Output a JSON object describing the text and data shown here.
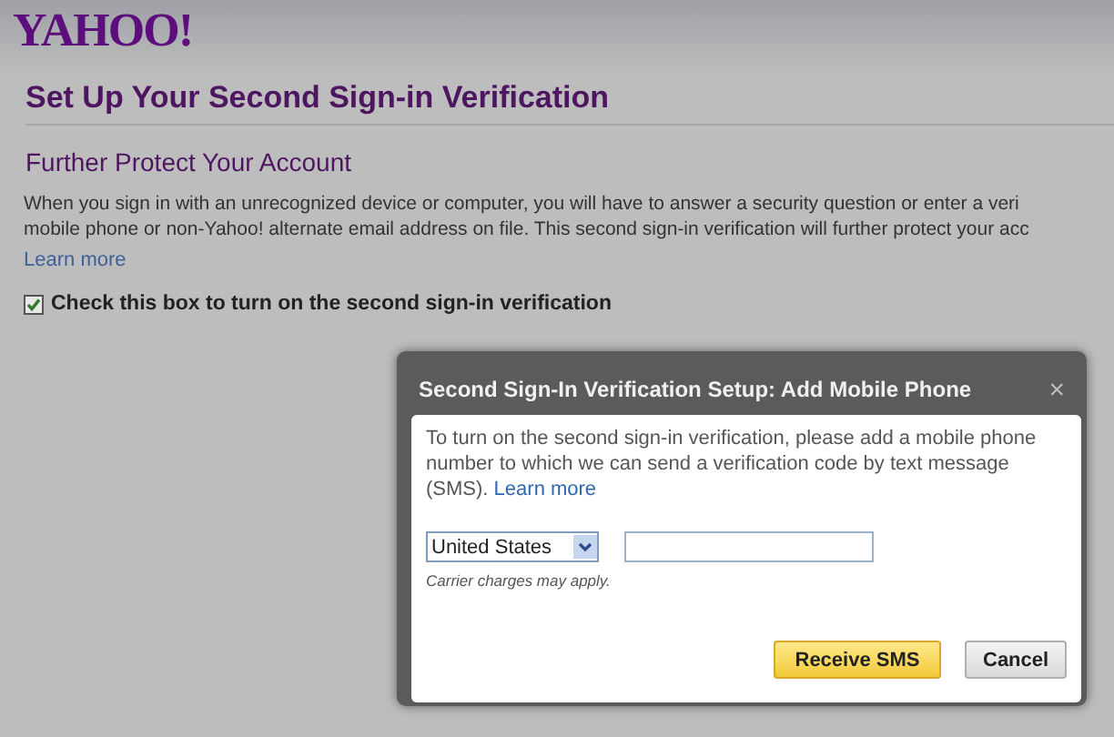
{
  "logo": "YAHOO!",
  "page_title": "Set Up Your Second Sign-in Verification",
  "section_title": "Further Protect Your Account",
  "description_lines": [
    "When you sign in with an unrecognized device or computer, you will have to answer a security question or enter a veri",
    "mobile phone or non-Yahoo! alternate email address on file. This second sign-in verification will further protect your acc"
  ],
  "learn_more": "Learn more",
  "enable_checkbox": {
    "label": "Check this box to turn on the second sign-in verification",
    "checked": true
  },
  "dialog": {
    "title": "Second Sign-In Verification Setup: Add Mobile Phone",
    "close": "×",
    "message": "To turn on the second sign-in verification, please add a mobile phone number to which we can send a verification code by text message (SMS).",
    "learn_more": "Learn more",
    "country": "United States",
    "carrier_note": "Carrier charges may apply.",
    "buttons": [
      {
        "label": "Receive SMS",
        "kind": "primary"
      },
      {
        "label": "Cancel",
        "kind": "secondary"
      }
    ]
  }
}
